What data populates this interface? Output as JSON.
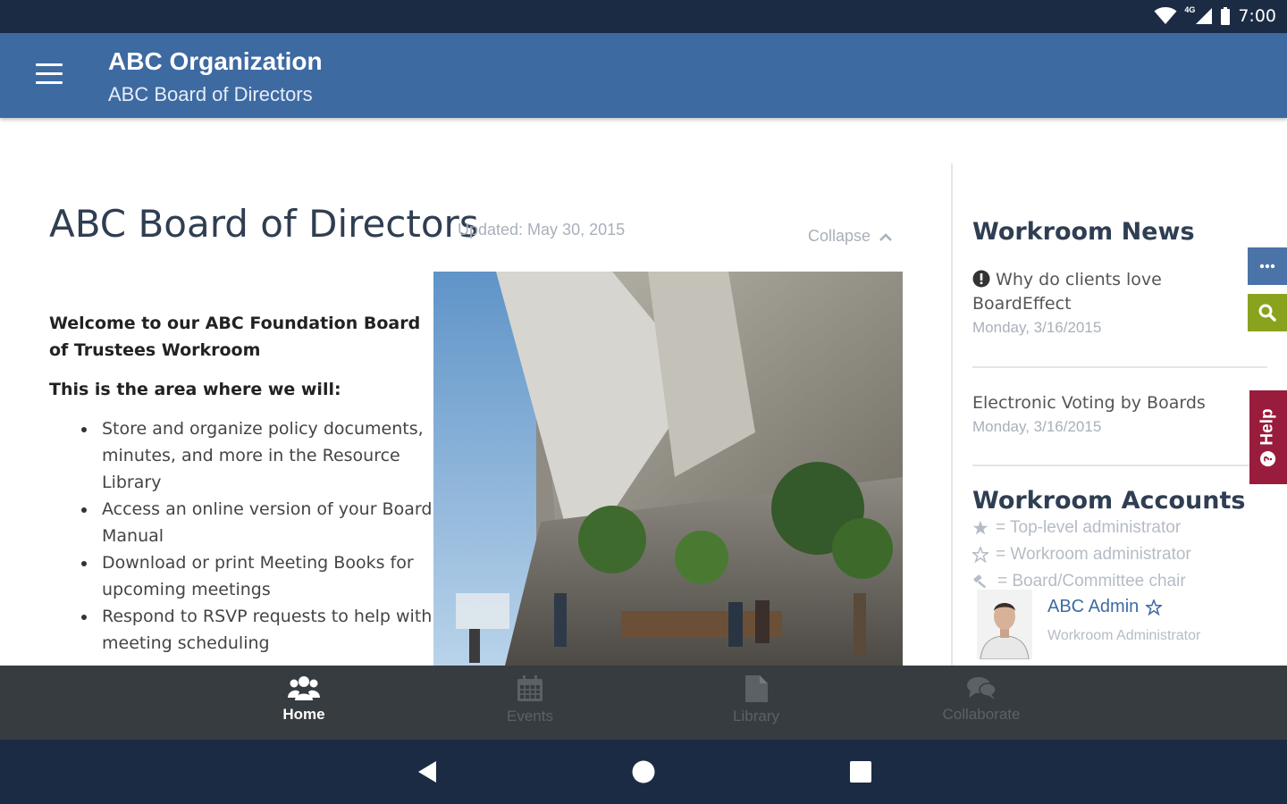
{
  "status_bar": {
    "time": "7:00",
    "network": "4G"
  },
  "app_bar": {
    "title": "ABC Organization",
    "subtitle": "ABC Board of Directors"
  },
  "main": {
    "title": "ABC Board of Directors",
    "updated": "Updated: May 30, 2015",
    "collapse_label": "Collapse",
    "welcome": "Welcome to our ABC Foundation Board of Trustees Workroom",
    "area_intro": "This is the area where we will:",
    "bullets": [
      "Store and organize policy documents, minutes, and more in the Resource Library",
      "Access an online version of your Board Manual",
      "Download or print Meeting Books for upcoming meetings",
      "Respond to RSVP requests to help with meeting scheduling"
    ]
  },
  "sidebar": {
    "news_title": "Workroom News",
    "news": [
      {
        "title": "Why do clients love BoardEffect",
        "date": "Monday, 3/16/2015"
      },
      {
        "title": "Electronic Voting by Boards",
        "date": "Monday, 3/16/2015"
      }
    ],
    "accounts_title": "Workroom Accounts",
    "legend": [
      {
        "icon": "star-filled-icon",
        "text": "= Top-level administrator"
      },
      {
        "icon": "star-outline-icon",
        "text": "= Workroom administrator"
      },
      {
        "icon": "gavel-icon",
        "text": "= Board/Committee chair"
      }
    ],
    "member": {
      "name": "ABC Admin",
      "role": "Workroom Administrator"
    }
  },
  "side_tabs": {
    "help_label": "Help"
  },
  "bottom_nav": [
    {
      "label": "Home",
      "icon": "users-icon",
      "active": true
    },
    {
      "label": "Events",
      "icon": "calendar-icon",
      "active": false
    },
    {
      "label": "Library",
      "icon": "document-icon",
      "active": false
    },
    {
      "label": "Collaborate",
      "icon": "chat-icon",
      "active": false
    }
  ],
  "colors": {
    "status_bar": "#1b2b44",
    "app_bar": "#3e6aa2",
    "bottom_nav": "#373c40",
    "search_tab": "#8aa31e",
    "help_tab": "#9a1c3c",
    "more_tab": "#4a73a8"
  }
}
